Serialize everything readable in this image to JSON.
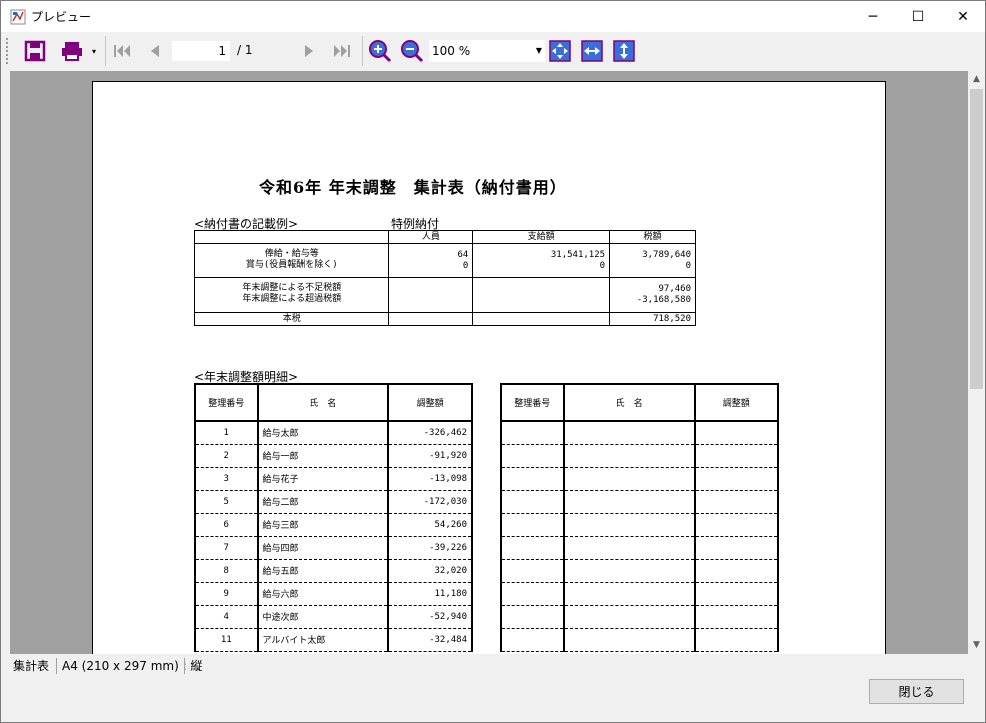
{
  "window": {
    "title": "プレビュー",
    "minimize_glyph": "─",
    "maximize_glyph": "☐",
    "close_glyph": "✕"
  },
  "toolbar": {
    "page_current": "1",
    "page_total": "/ 1",
    "zoom": "100 %",
    "icons": [
      "save-icon",
      "print-icon",
      "first-page-icon",
      "prev-page-icon",
      "next-page-icon",
      "last-page-icon",
      "zoom-in-icon",
      "zoom-out-icon",
      "fit-page-icon",
      "fit-width-icon",
      "fit-height-icon"
    ],
    "accent": "#800080"
  },
  "document": {
    "title": "令和6年 年末調整　集計表（納付書用）",
    "summary_label": "<納付書の記載例>",
    "special_label": "特例納付",
    "summary": {
      "headers": [
        "",
        "人員",
        "支給額",
        "税額"
      ],
      "rows": [
        {
          "label1": "俸給・給与等",
          "label2": "賞与(役員報酬を除く)",
          "people": [
            "64",
            "0"
          ],
          "paid": [
            "31,541,125",
            "0"
          ],
          "tax": [
            "3,789,640",
            "0"
          ]
        },
        {
          "label1": "年末調整による不足税額",
          "label2": "年末調整による超過税額",
          "people": [
            "",
            ""
          ],
          "paid": [
            "",
            ""
          ],
          "tax": [
            "97,460",
            "-3,168,580"
          ]
        },
        {
          "label1": "本税",
          "tax": "718,520"
        }
      ]
    },
    "detail_label": "<年末調整額明細>",
    "detail_headers": [
      "整理番号",
      "氏　名",
      "調整額"
    ],
    "detail_rows": [
      {
        "no": "1",
        "name": "給与太郎",
        "amount": "-326,462"
      },
      {
        "no": "2",
        "name": "給与一郎",
        "amount": "-91,920"
      },
      {
        "no": "3",
        "name": "給与花子",
        "amount": "-13,098"
      },
      {
        "no": "5",
        "name": "給与二郎",
        "amount": "-172,030"
      },
      {
        "no": "6",
        "name": "給与三郎",
        "amount": "54,260"
      },
      {
        "no": "7",
        "name": "給与四郎",
        "amount": "-39,226"
      },
      {
        "no": "8",
        "name": "給与五郎",
        "amount": "32,020"
      },
      {
        "no": "9",
        "name": "給与六郎",
        "amount": "11,180"
      },
      {
        "no": "4",
        "name": "中途次郎",
        "amount": "-52,940"
      },
      {
        "no": "11",
        "name": "アルバイト太郎",
        "amount": "-32,484"
      }
    ]
  },
  "statusbar": {
    "name": "集計表",
    "paper": "A4 (210 x 297 mm) : 縦"
  },
  "footer": {
    "close_label": "閉じる"
  }
}
